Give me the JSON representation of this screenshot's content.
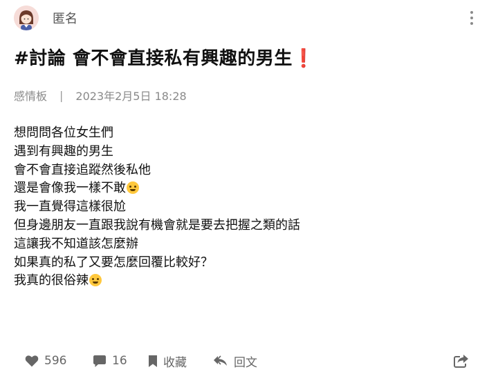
{
  "post": {
    "author": "匿名",
    "title": "#討論 會不會直接私有興趣的男生",
    "title_emoji": "❗",
    "board": "感情板",
    "date": "2023年2月5日 18:28",
    "content_lines": [
      "想問問各位女生們",
      "遇到有興趣的男生",
      "會不會直接追蹤然後私他",
      "還是會像我一樣不敢",
      "我一直覺得這樣很尬",
      "但身邊朋友一直跟我說有機會就是要去把握之類的話",
      "這讓我不知道該怎麼辦",
      "如果真的私了又要怎麼回覆比較好？",
      "我真的很俗辣"
    ]
  },
  "actions": {
    "likes": "596",
    "comments": "16",
    "save_label": "收藏",
    "reply_label": "回文"
  },
  "icons": {
    "avatar": "girl-avatar-icon",
    "more": "more-vertical-icon",
    "like": "heart-icon",
    "comment": "comment-icon",
    "save": "bookmark-icon",
    "reply": "reply-icon",
    "share": "share-icon",
    "emoji_1": "teary-smile-emoji",
    "emoji_2": "tired-face-emoji"
  },
  "colors": {
    "accent_red": "#e0263c",
    "meta_gray": "#8a8a8a",
    "icon_gray": "#666666"
  }
}
